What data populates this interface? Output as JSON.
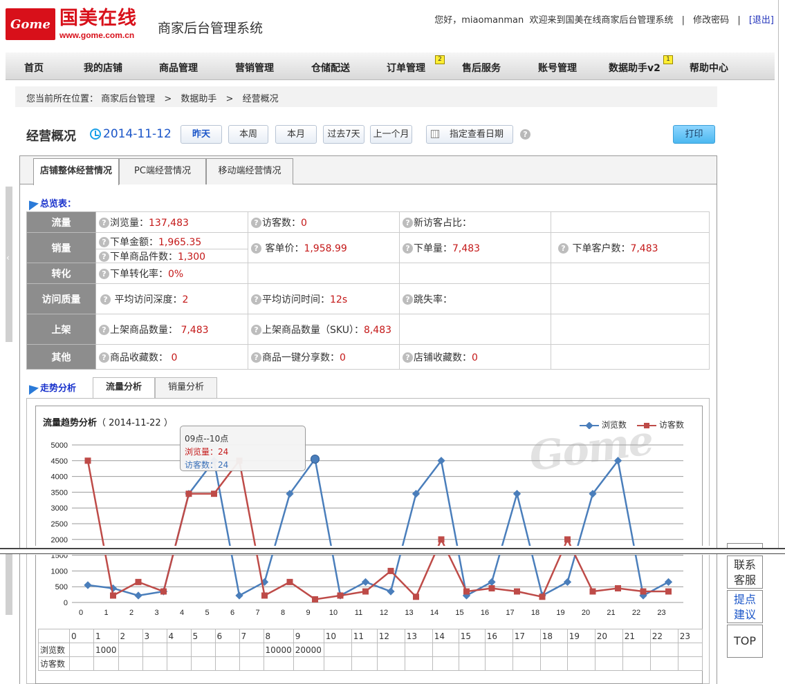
{
  "header": {
    "logo_text": "Gome",
    "logo_cn": "国美在线",
    "logo_url": "www.gome.com.cn",
    "system_title": "商家后台管理系统",
    "greeting": "您好，miaomanman",
    "welcome": "欢迎来到国美在线商家后台管理系统",
    "sep": "|",
    "change_password": "修改密码",
    "logout": "[退出]"
  },
  "nav": {
    "items": [
      {
        "label": "首页"
      },
      {
        "label": "我的店铺"
      },
      {
        "label": "商品管理"
      },
      {
        "label": "营销管理"
      },
      {
        "label": "仓储配送"
      },
      {
        "label": "订单管理",
        "badge": "2"
      },
      {
        "label": "售后服务"
      },
      {
        "label": "账号管理"
      },
      {
        "label": "数据助手v2",
        "badge": "1"
      },
      {
        "label": "帮助中心"
      }
    ]
  },
  "breadcrumb": {
    "prefix": "您当前所在位置：",
    "items": [
      "商家后台管理",
      "数据助手",
      "经营概况"
    ],
    "sep": ">"
  },
  "toolbar": {
    "page_title": "经营概况",
    "date": "2014-11-12",
    "buttons": [
      "昨天",
      "本周",
      "本月",
      "过去7天",
      "上一个月"
    ],
    "pick_date": "指定查看日期",
    "help": "?",
    "print": "打印"
  },
  "tabs": [
    "店铺整体经营情况",
    "PC端经营情况",
    "移动端经营情况"
  ],
  "overview": {
    "label": "总览表：",
    "rows": {
      "traffic": {
        "header": "流量",
        "pv_label": "浏览量：",
        "pv": "137,483",
        "uv_label": "访客数：",
        "uv": "0",
        "new_label": "新访客占比："
      },
      "sales": {
        "header": "销量",
        "amount_label": "下单金额：",
        "amount": "1,965.35",
        "items_label": "下单商品件数：",
        "items": "1,300",
        "avg_label": "客单价：",
        "avg": "1,958.99",
        "orders_label": "下单量：",
        "orders": "7,483",
        "customers_label": "下单客户数：",
        "customers": "7,483"
      },
      "conversion": {
        "header": "转化",
        "rate_label": "下单转化率：",
        "rate": "0%"
      },
      "quality": {
        "header": "访问质量",
        "depth_label": "平均访问深度：",
        "depth": "2",
        "time_label": "平均访问时间：",
        "time": "12s",
        "bounce_label": "跳失率："
      },
      "listing": {
        "header": "上架",
        "count_label": "上架商品数量：",
        "count": "7,483",
        "sku_label": "上架商品数量（SKU）：",
        "sku": "8,483"
      },
      "other": {
        "header": "其他",
        "fav_label": "商品收藏数：",
        "fav": "0",
        "share_label": "商品一键分享数：",
        "share": "0",
        "shop_fav_label": "店铺收藏数：",
        "shop_fav": "0"
      }
    }
  },
  "trend": {
    "label": "走势分析",
    "tabs": [
      "流量分析",
      "销量分析"
    ],
    "chart_title": "流量趋势分析",
    "chart_date": "（ 2014-11-22 ）",
    "watermark": "Gome",
    "tooltip": {
      "title": "09点--10点",
      "pv_label": "浏览量：",
      "pv": "24",
      "uv_label": "访客数：",
      "uv": "24"
    },
    "table": {
      "hours": [
        "0",
        "1",
        "2",
        "3",
        "4",
        "5",
        "6",
        "7",
        "8",
        "9",
        "10",
        "11",
        "12",
        "13",
        "14",
        "15",
        "16",
        "17",
        "18",
        "19",
        "20",
        "21",
        "22",
        "23"
      ],
      "row_labels": [
        "浏览数",
        "访客数"
      ],
      "pv_cells": [
        "",
        "1000",
        "",
        "",
        "",
        "",
        "",
        "",
        "10000",
        "20000",
        "",
        "",
        "",
        "",
        "",
        "",
        "",
        "",
        "",
        "",
        "",
        "",
        "",
        ""
      ],
      "uv_cells": [
        "",
        "",
        "",
        "",
        "",
        "",
        "",
        "",
        "",
        "",
        "",
        "",
        "",
        "",
        "",
        "",
        "",
        "",
        "",
        "",
        "",
        "",
        "",
        ""
      ]
    }
  },
  "float": {
    "contact": "联系客服",
    "suggest": "提点建议",
    "top": "TOP"
  },
  "chart_data": {
    "type": "line",
    "x": [
      "0",
      "1",
      "2",
      "3",
      "4",
      "5",
      "6",
      "7",
      "8",
      "9",
      "10",
      "11",
      "12",
      "13",
      "14",
      "15",
      "16",
      "17",
      "18",
      "19",
      "20",
      "21",
      "22",
      "23"
    ],
    "ylim": [
      0,
      5000
    ],
    "yticks": [
      0,
      500,
      1000,
      1500,
      2000,
      2500,
      3000,
      3500,
      4000,
      4500,
      5000
    ],
    "series": [
      {
        "name": "浏览数",
        "color": "#4a7ebb",
        "values": [
          550,
          450,
          220,
          350,
          3450,
          4500,
          220,
          650,
          3450,
          4550,
          220,
          650,
          350,
          3450,
          4500,
          220,
          650,
          3450,
          220,
          650,
          3450,
          4500,
          220,
          650
        ]
      },
      {
        "name": "访客数",
        "color": "#be4b48",
        "values": [
          4500,
          220,
          650,
          350,
          3450,
          3450,
          4500,
          220,
          650,
          100,
          220,
          350,
          1000,
          180,
          2000,
          350,
          450,
          350,
          180,
          2000,
          350,
          450,
          350,
          350
        ]
      }
    ]
  }
}
